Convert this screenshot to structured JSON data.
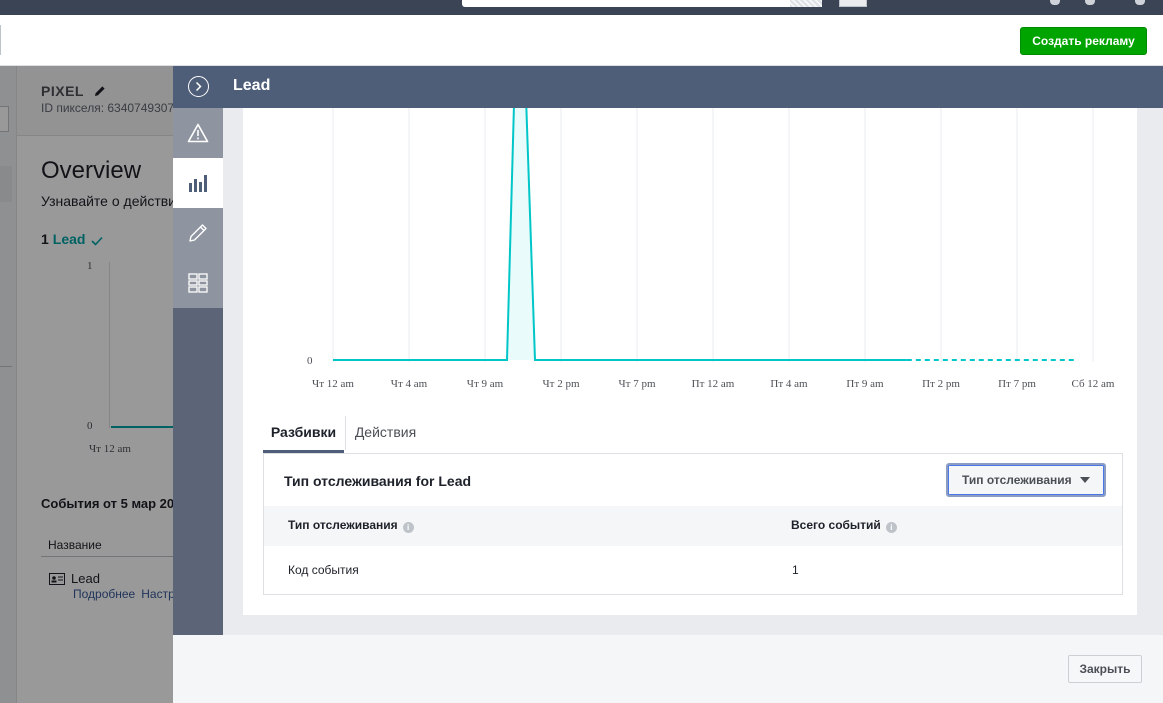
{
  "header": {
    "create_ad_label": "Создать рекламу"
  },
  "background_page": {
    "pixel_label": "PIXEL",
    "pixel_id_text": "ID пикселя: 6340749307",
    "overview_title": "Overview",
    "overview_subtitle": "Узнавайте о действи",
    "lead_count": "1",
    "lead_label": "Lead",
    "mini_chart": {
      "y_top": "1",
      "y_bottom": "0",
      "x_first": "Чт 12 am"
    },
    "events_title": "События от 5 мар 20",
    "table_header_name": "Название",
    "row_name": "Lead",
    "row_link_details": "Подробнее",
    "row_link_settings": "Настр"
  },
  "dialog": {
    "title": "Lead",
    "rail_icons": [
      "warning-icon",
      "bar-chart-icon",
      "pencil-icon",
      "grid-icon"
    ],
    "tabs": {
      "breakdowns": "Разбивки",
      "actions": "Действия"
    },
    "panel": {
      "title": "Тип отслеживания for Lead",
      "dropdown_label": "Тип отслеживания",
      "columns": {
        "type": "Тип отслеживания",
        "total": "Всего событий"
      },
      "rows": [
        {
          "type": "Код события",
          "total": "1"
        }
      ]
    },
    "close_label": "Закрыть"
  },
  "chart_data": {
    "type": "area",
    "x": [
      "Чт 12 am",
      "Чт 4 am",
      "Чт 9 am",
      "Чт 2 pm",
      "Чт 7 pm",
      "Пт 12 am",
      "Пт 4 am",
      "Пт 9 am",
      "Пт 2 pm",
      "Пт 7 pm",
      "Сб 12 am"
    ],
    "series": [
      {
        "values": [
          0,
          0,
          0,
          1,
          0,
          0,
          0,
          0,
          0,
          0,
          0
        ]
      }
    ],
    "y_tick_labels": [
      "0"
    ],
    "ylim": [
      0,
      1
    ],
    "grid": true,
    "colors": {
      "line": "#00c6c8",
      "fill": "#e9fbfb"
    },
    "dashed_from": "Пт 9 am"
  },
  "colors": {
    "header_bg": "#4e5d78",
    "create_button": "#00a400",
    "accent_teal": "#00a4a6",
    "link": "#385898"
  }
}
